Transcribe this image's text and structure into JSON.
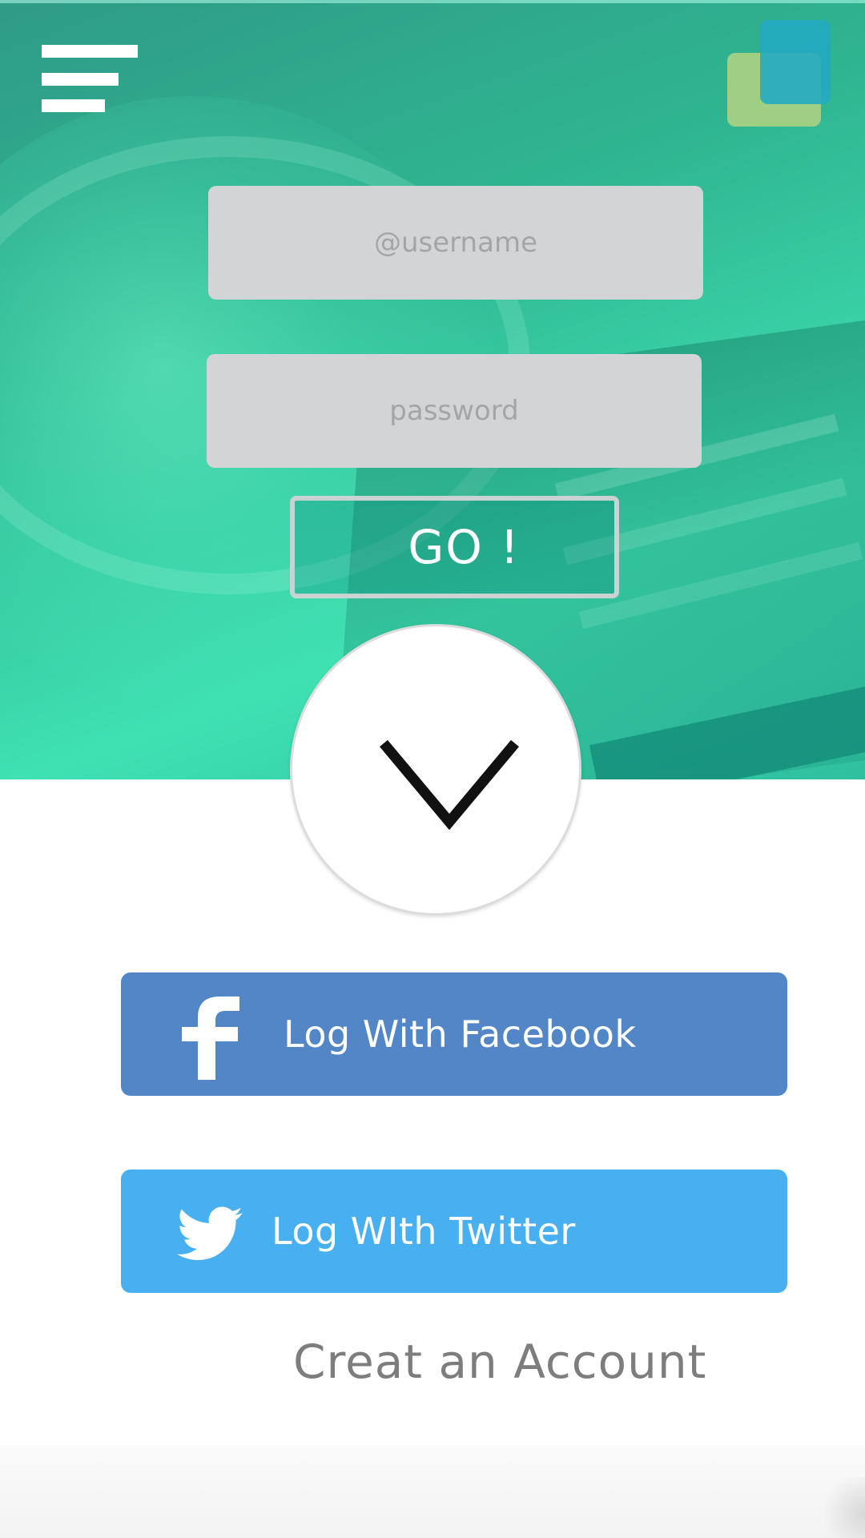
{
  "login_form": {
    "username_placeholder": "@username",
    "password_placeholder": "password",
    "go_label": "GO !"
  },
  "social": {
    "facebook_label": "Log With Facebook",
    "twitter_label": "Log WIth Twitter"
  },
  "footer": {
    "create_account_label": "Creat an Account"
  },
  "icons": {
    "menu": "hamburger-menu-icon",
    "logo": "overlapping-squares-logo",
    "scroll": "chevron-down-icon",
    "facebook": "facebook-icon",
    "twitter": "twitter-icon"
  },
  "colors": {
    "overlay_teal": "#2fb591",
    "logo_green": "#9fcf85",
    "logo_blue": "#22aac3",
    "input_gray": "#d3d4d6",
    "facebook_blue": "#5286c7",
    "twitter_blue": "#48b0f0",
    "link_gray": "#7d7d7d"
  }
}
